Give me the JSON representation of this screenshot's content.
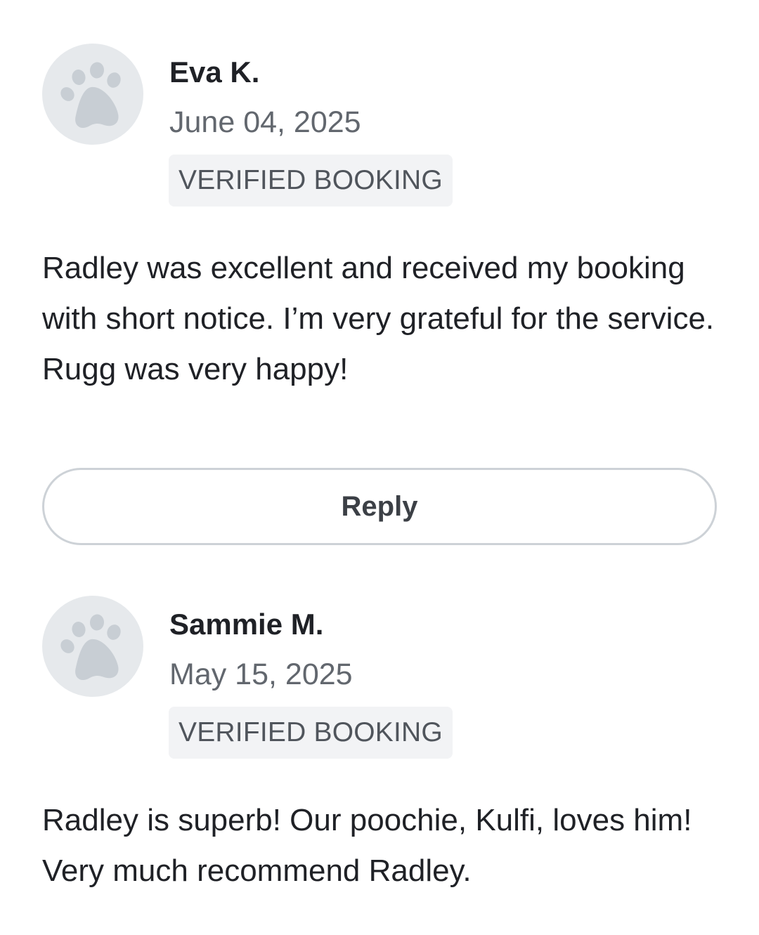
{
  "reviews": [
    {
      "avatar_icon": "paw-icon",
      "name": "Eva K.",
      "date": "June 04, 2025",
      "badge": "VERIFIED BOOKING",
      "text": "Radley was excellent and received my booking with short notice. I’m very grateful for the service. Rugg was very happy!"
    },
    {
      "avatar_icon": "paw-icon",
      "name": "Sammie M.",
      "date": "May 15, 2025",
      "badge": "VERIFIED BOOKING",
      "text": "Radley is superb! Our poochie, Kulfi, loves him! Very much recommend Radley."
    }
  ],
  "reply_button": {
    "label": "Reply"
  },
  "colors": {
    "avatar_bg": "#e6e9ec",
    "paw": "#c8ced4",
    "badge_bg": "#f2f3f5",
    "button_border": "#cdd2d7",
    "text_primary": "#1f2126",
    "text_secondary": "#62676e"
  }
}
